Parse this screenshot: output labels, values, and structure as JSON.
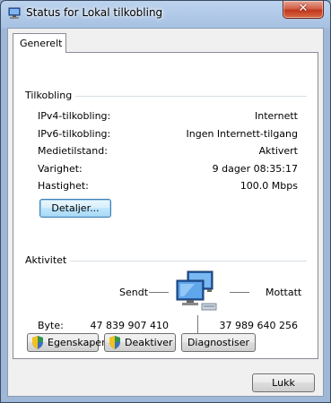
{
  "window": {
    "title": "Status for Lokal tilkobling"
  },
  "tabs": [
    {
      "label": "Generelt"
    }
  ],
  "connection": {
    "group_label": "Tilkobling",
    "rows": [
      {
        "label": "IPv4-tilkobling:",
        "value": "Internett"
      },
      {
        "label": "IPv6-tilkobling:",
        "value": "Ingen Internett-tilgang"
      },
      {
        "label": "Medietilstand:",
        "value": "Aktivert"
      },
      {
        "label": "Varighet:",
        "value": "9 dager 08:35:17"
      },
      {
        "label": "Hastighet:",
        "value": "100.0 Mbps"
      }
    ],
    "details_button": "Detaljer..."
  },
  "activity": {
    "group_label": "Aktivitet",
    "sent_label": "Sendt",
    "received_label": "Mottatt",
    "bytes_label": "Byte:",
    "bytes_sent": "47 839 907 410",
    "bytes_received": "37 989 640 256"
  },
  "actions": {
    "properties": "Egenskaper",
    "disable": "Deaktiver",
    "diagnose": "Diagnostiser"
  },
  "footer": {
    "close": "Lukk"
  },
  "icons": {
    "app": "network-icon",
    "close": "close-icon",
    "shield": "uac-shield-icon",
    "activity": "network-computers-icon"
  }
}
